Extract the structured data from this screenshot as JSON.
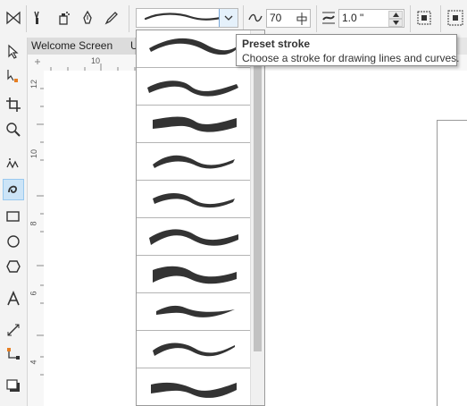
{
  "property_bar": {
    "smoothing_value": "70",
    "stroke_width_value": "1.0 \""
  },
  "tabs": [
    {
      "label": "Welcome Screen"
    },
    {
      "label": "U"
    }
  ],
  "rulers": {
    "horizontal": [
      "10"
    ],
    "vertical": [
      "12",
      "10",
      "8",
      "6",
      "4"
    ]
  },
  "tooltip": {
    "title": "Preset stroke",
    "description": "Choose a stroke for drawing lines and curves."
  },
  "icons": {
    "property_bar": [
      "freehand-mode-icon",
      "brush-icon",
      "sprayer-icon",
      "calligraphic-icon",
      "expression-icon",
      "smoothing-icon",
      "stroke-width-icon",
      "edit-fill-icon",
      "align-icon"
    ],
    "toolbox": [
      "pick-tool-icon",
      "shape-tool-icon",
      "crop-tool-icon",
      "zoom-tool-icon",
      "freehand-tool-icon",
      "artistic-media-tool-icon",
      "rectangle-tool-icon",
      "ellipse-tool-icon",
      "polygon-tool-icon",
      "text-tool-icon",
      "parallel-dimension-tool-icon",
      "connector-tool-icon",
      "drop-shadow-tool-icon"
    ]
  },
  "colors": {
    "stroke": "#333333",
    "highlight": "#cce4f7"
  }
}
